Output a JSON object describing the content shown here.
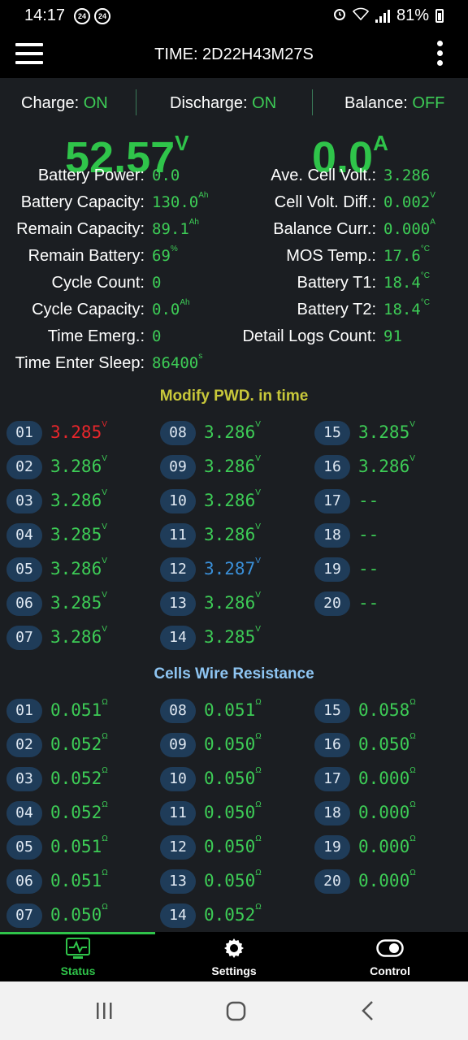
{
  "status_bar": {
    "time": "14:17",
    "notif_badges": [
      "24",
      "24"
    ],
    "battery_percent": "81%"
  },
  "app_bar": {
    "title": "TIME: 2D22H43M27S",
    "menu_icon": "hamburger-menu-icon",
    "more_icon": "more-vert-icon"
  },
  "modes": [
    {
      "label": "Charge:",
      "state": "ON"
    },
    {
      "label": "Discharge:",
      "state": "ON"
    },
    {
      "label": "Balance:",
      "state": "OFF"
    }
  ],
  "voltage": {
    "value": "52.57",
    "unit": "V"
  },
  "current": {
    "value": "0.0",
    "unit": "A"
  },
  "info_left": [
    {
      "label": "Battery Power:",
      "value": "0.0",
      "unit": ""
    },
    {
      "label": "Battery Capacity:",
      "value": "130.0",
      "unit": "Ah"
    },
    {
      "label": "Remain Capacity:",
      "value": "89.1",
      "unit": "Ah"
    },
    {
      "label": "Remain Battery:",
      "value": "69",
      "unit": "%"
    },
    {
      "label": "Cycle Count:",
      "value": "0",
      "unit": ""
    },
    {
      "label": "Cycle Capacity:",
      "value": "0.0",
      "unit": "Ah"
    },
    {
      "label": "Time Emerg.:",
      "value": "0",
      "unit": ""
    },
    {
      "label": "Time Enter Sleep:",
      "value": "86400",
      "unit": "s"
    }
  ],
  "info_right": [
    {
      "label": "Ave. Cell Volt.:",
      "value": "3.286",
      "unit": ""
    },
    {
      "label": "Cell Volt. Diff.:",
      "value": "0.002",
      "unit": "V"
    },
    {
      "label": "Balance Curr.:",
      "value": "0.000",
      "unit": "A"
    },
    {
      "label": "MOS Temp.:",
      "value": "17.6",
      "unit": "°C"
    },
    {
      "label": "Battery T1:",
      "value": "18.4",
      "unit": "°C"
    },
    {
      "label": "Battery T2:",
      "value": "18.4",
      "unit": "°C"
    },
    {
      "label": "Detail Logs Count:",
      "value": "91",
      "unit": ""
    }
  ],
  "cells_title": "Modify PWD. in time",
  "cell_voltages": [
    {
      "id": "01",
      "value": "3.285",
      "unit": "V",
      "color": "#e8262b"
    },
    {
      "id": "02",
      "value": "3.286",
      "unit": "V",
      "color": "#3dcc56"
    },
    {
      "id": "03",
      "value": "3.286",
      "unit": "V",
      "color": "#3dcc56"
    },
    {
      "id": "04",
      "value": "3.285",
      "unit": "V",
      "color": "#3dcc56"
    },
    {
      "id": "05",
      "value": "3.286",
      "unit": "V",
      "color": "#3dcc56"
    },
    {
      "id": "06",
      "value": "3.285",
      "unit": "V",
      "color": "#3dcc56"
    },
    {
      "id": "07",
      "value": "3.286",
      "unit": "V",
      "color": "#3dcc56"
    },
    {
      "id": "08",
      "value": "3.286",
      "unit": "V",
      "color": "#3dcc56"
    },
    {
      "id": "09",
      "value": "3.286",
      "unit": "V",
      "color": "#3dcc56"
    },
    {
      "id": "10",
      "value": "3.286",
      "unit": "V",
      "color": "#3dcc56"
    },
    {
      "id": "11",
      "value": "3.286",
      "unit": "V",
      "color": "#3dcc56"
    },
    {
      "id": "12",
      "value": "3.287",
      "unit": "V",
      "color": "#3a8fd8"
    },
    {
      "id": "13",
      "value": "3.286",
      "unit": "V",
      "color": "#3dcc56"
    },
    {
      "id": "14",
      "value": "3.285",
      "unit": "V",
      "color": "#3dcc56"
    },
    {
      "id": "15",
      "value": "3.285",
      "unit": "V",
      "color": "#3dcc56"
    },
    {
      "id": "16",
      "value": "3.286",
      "unit": "V",
      "color": "#3dcc56"
    },
    {
      "id": "17",
      "value": "--",
      "unit": "",
      "color": "#3dcc56"
    },
    {
      "id": "18",
      "value": "--",
      "unit": "",
      "color": "#3dcc56"
    },
    {
      "id": "19",
      "value": "--",
      "unit": "",
      "color": "#3dcc56"
    },
    {
      "id": "20",
      "value": "--",
      "unit": "",
      "color": "#3dcc56"
    }
  ],
  "resistance_title": "Cells Wire Resistance",
  "cell_resistances": [
    {
      "id": "01",
      "value": "0.051",
      "unit": "Ω"
    },
    {
      "id": "02",
      "value": "0.052",
      "unit": "Ω"
    },
    {
      "id": "03",
      "value": "0.052",
      "unit": "Ω"
    },
    {
      "id": "04",
      "value": "0.052",
      "unit": "Ω"
    },
    {
      "id": "05",
      "value": "0.051",
      "unit": "Ω"
    },
    {
      "id": "06",
      "value": "0.051",
      "unit": "Ω"
    },
    {
      "id": "07",
      "value": "0.050",
      "unit": "Ω"
    },
    {
      "id": "08",
      "value": "0.051",
      "unit": "Ω"
    },
    {
      "id": "09",
      "value": "0.050",
      "unit": "Ω"
    },
    {
      "id": "10",
      "value": "0.050",
      "unit": "Ω"
    },
    {
      "id": "11",
      "value": "0.050",
      "unit": "Ω"
    },
    {
      "id": "12",
      "value": "0.050",
      "unit": "Ω"
    },
    {
      "id": "13",
      "value": "0.050",
      "unit": "Ω"
    },
    {
      "id": "14",
      "value": "0.052",
      "unit": "Ω"
    },
    {
      "id": "15",
      "value": "0.058",
      "unit": "Ω"
    },
    {
      "id": "16",
      "value": "0.050",
      "unit": "Ω"
    },
    {
      "id": "17",
      "value": "0.000",
      "unit": "Ω"
    },
    {
      "id": "18",
      "value": "0.000",
      "unit": "Ω"
    },
    {
      "id": "19",
      "value": "0.000",
      "unit": "Ω"
    },
    {
      "id": "20",
      "value": "0.000",
      "unit": "Ω"
    }
  ],
  "bottom_nav": [
    {
      "label": "Status",
      "icon": "pulse-monitor-icon",
      "active": true
    },
    {
      "label": "Settings",
      "icon": "gear-icon",
      "active": false
    },
    {
      "label": "Control",
      "icon": "toggle-icon",
      "active": false
    }
  ],
  "colors": {
    "accent_green": "#2fc44a",
    "value_green": "#3dcc56",
    "title_yellow": "#c8c83a",
    "title_blue": "#8ec5f2",
    "badge_bg": "#1f3c59"
  }
}
